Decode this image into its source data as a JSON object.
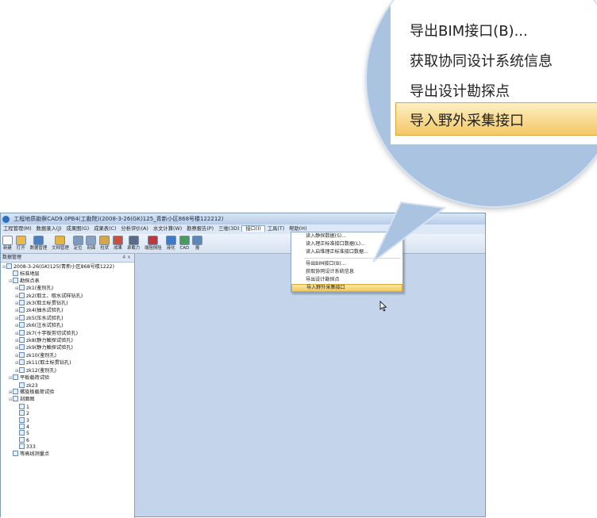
{
  "window": {
    "title": "工程地质勘察CAD9.0PB4(工勘院)(2008-3-26(GK)125_青新小区868号楼122212)"
  },
  "menubar": [
    "工程管理(M)",
    "数据录入(J)",
    "成果图(G)",
    "成果表(C)",
    "分析评价(A)",
    "水文计算(W)",
    "勘察报告(P)",
    "三维(3D)",
    "接口(I)",
    "工具(T)",
    "帮助(H)"
  ],
  "active_menu": "接口(I)",
  "toolbar": [
    {
      "label": "新建",
      "icon": "new-file-icon",
      "color": "#ffffff"
    },
    {
      "label": "打开",
      "icon": "open-folder-icon",
      "color": "#e9b949"
    },
    {
      "label": "数据管理",
      "icon": "database-icon",
      "color": "#4c7fbf"
    },
    {
      "label": "文档管理",
      "icon": "document-folder-icon",
      "color": "#e4b440"
    },
    {
      "label": "定位",
      "icon": "locate-icon",
      "color": "#7e99bd"
    },
    {
      "label": "剖面",
      "icon": "section-icon",
      "color": "#8aa2c2"
    },
    {
      "label": "柱状",
      "icon": "column-icon",
      "color": "#d6a64a"
    },
    {
      "label": "成果",
      "icon": "results-icon",
      "color": "#c84f3c"
    },
    {
      "label": "承载力",
      "icon": "bearing-icon",
      "color": "#5b6a86"
    },
    {
      "label": "端阻侧阻",
      "icon": "resistance-icon",
      "color": "#c0363b"
    },
    {
      "label": "液化",
      "icon": "liquefaction-icon",
      "color": "#3e7bc4"
    },
    {
      "label": "CAD",
      "icon": "cad-icon",
      "color": "#4a9c5a"
    },
    {
      "label": "报",
      "icon": "report-icon",
      "color": "#5f86b8"
    }
  ],
  "dock": {
    "title": "数据管理",
    "pin": "4 ×"
  },
  "tree": [
    {
      "label": "2008-3-26(GK)125(青新小区868号楼1222)",
      "depth": 0,
      "pm": "⊟"
    },
    {
      "label": "标准地层",
      "depth": 1,
      "pm": ""
    },
    {
      "label": "勘探点表",
      "depth": 1,
      "pm": "⊟"
    },
    {
      "label": "zk1(鉴别孔)",
      "depth": 2,
      "pm": "⊞"
    },
    {
      "label": "zk2(取土、取水试样钻孔)",
      "depth": 2,
      "pm": "⊞"
    },
    {
      "label": "zk3(取土标贯钻孔)",
      "depth": 2,
      "pm": "⊞"
    },
    {
      "label": "zk4(抽水试验孔)",
      "depth": 2,
      "pm": "⊞"
    },
    {
      "label": "zk5(压水试验孔)",
      "depth": 2,
      "pm": "⊞"
    },
    {
      "label": "zk6(注水试验孔)",
      "depth": 2,
      "pm": "⊞"
    },
    {
      "label": "zk7(十字板剪切试验孔)",
      "depth": 2,
      "pm": "⊞"
    },
    {
      "label": "zk8(静力触探试验孔)",
      "depth": 2,
      "pm": "⊞"
    },
    {
      "label": "zk9(静力触探试验孔)",
      "depth": 2,
      "pm": "⊞"
    },
    {
      "label": "zk10(鉴别孔)",
      "depth": 2,
      "pm": "⊞"
    },
    {
      "label": "zk11(取土标贯钻孔)",
      "depth": 2,
      "pm": "⊞"
    },
    {
      "label": "zk12(鉴别孔)",
      "depth": 2,
      "pm": "⊞"
    },
    {
      "label": "平板载荷试验",
      "depth": 1,
      "pm": "⊟"
    },
    {
      "label": "zk23",
      "depth": 2,
      "pm": ""
    },
    {
      "label": "螺旋板载荷试验",
      "depth": 1,
      "pm": "⊞"
    },
    {
      "label": "剖面图",
      "depth": 1,
      "pm": "⊟"
    },
    {
      "label": "1",
      "depth": 2,
      "pm": ""
    },
    {
      "label": "2",
      "depth": 2,
      "pm": ""
    },
    {
      "label": "3",
      "depth": 2,
      "pm": ""
    },
    {
      "label": "4",
      "depth": 2,
      "pm": ""
    },
    {
      "label": "5",
      "depth": 2,
      "pm": ""
    },
    {
      "label": "6",
      "depth": 2,
      "pm": ""
    },
    {
      "label": "333",
      "depth": 2,
      "pm": ""
    },
    {
      "label": "等高线测量点",
      "depth": 1,
      "pm": ""
    }
  ],
  "dropdown": {
    "group1": [
      "读入静探数据(S)...",
      "读入理正标准接口数据(L)...",
      "读入启维理正标准接口数据..."
    ],
    "group2": [
      "导出BIM接口(B)...",
      "获取协同设计系统信息",
      "导出设计勘探点"
    ],
    "highlighted": "导入野外采集接口"
  },
  "zoom": {
    "items": [
      "导出BIM接口(B)...",
      "获取协同设计系统信息",
      "导出设计勘探点"
    ],
    "highlighted": "导入野外采集接口",
    "hl_color": "#f4c867",
    "circle_color": "#aac3e1"
  }
}
